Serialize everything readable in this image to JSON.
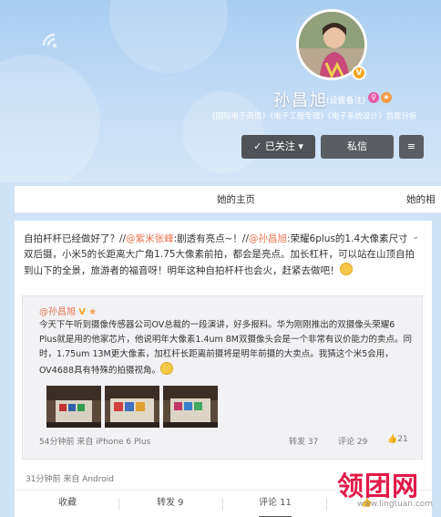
{
  "profile": {
    "name": "孙昌旭",
    "remark": "(设置备注)",
    "tags": "《国际电子商情》《电子工程专辑》《电子系统设计》首席分析",
    "follow_label": "✓ 已关注 ▾",
    "message_label": "私信",
    "more_label": "≡"
  },
  "tabs": {
    "home": "她的主页",
    "albums": "她的相"
  },
  "post": {
    "text_1": "自拍杆杆已经做好了？//",
    "mention_1": "@紫米张峰",
    "text_2": ":剧透有亮点~！//",
    "mention_2": "@孙昌旭",
    "text_3": ":荣耀6plus的1.4大像素尺寸双后摄，小米5的长距离大广角1.75大像素前拍，都会是亮点。加长杠杆，可以站在山顶自拍到山下的全景，旅游者的福音呀！明年这种自拍杆杆也会火，赶紧去做吧！",
    "meta": "31分钟前 来自 Android",
    "actions": {
      "favorite": "收藏",
      "forward": "转发 9",
      "comment": "评论 11",
      "like": "👍"
    }
  },
  "quoted": {
    "user": "@孙昌旭",
    "text": "今天下午听到摄像传感器公司OV总裁的一段演讲，好多报料。华为刚刚推出的双摄像头荣耀6 Plus就是用的他家芯片，他说明年大像素1.4um 8M双摄像头会是一个非常有议价能力的卖点。同时，1.75um 13M更大像素，加杠杆长距离前摄将是明年前摄的大卖点。我猜这个米5会用，OV4688具有特殊的拍摄视角。",
    "meta": "54分钟前 来自 iPhone 6 Plus",
    "forward": "转发 37",
    "comment": "评论 29",
    "like": "21"
  },
  "watermark": {
    "logo": "领团网",
    "url": "www.lingtuan.com"
  }
}
